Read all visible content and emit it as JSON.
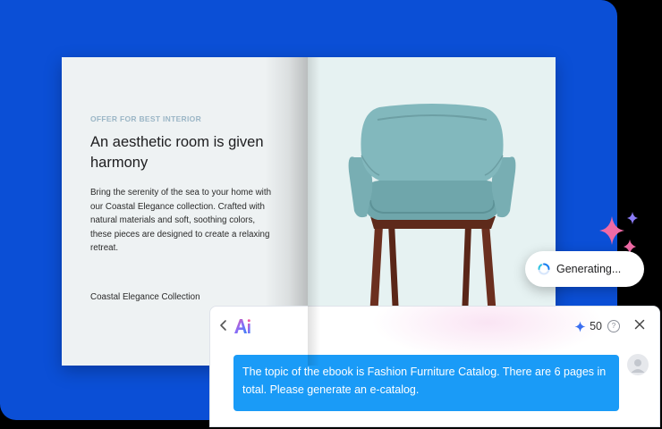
{
  "book": {
    "kicker": "OFFER FOR BEST INTERIOR",
    "headline": "An aesthetic room is given harmony",
    "body": "Bring the serenity of the sea to your home with our Coastal Elegance collection. Crafted with natural materials and soft, soothing colors, these pieces are designed to create a relaxing retreat.",
    "collection": "Coastal Elegance Collection",
    "image_icon": "armchair-image"
  },
  "status": {
    "generating_label": "Generating...",
    "icon": "loading-spinner-icon"
  },
  "chat": {
    "back_icon": "chevron-left-icon",
    "logo_text": "Ai",
    "credits": "50",
    "credit_icon": "sparkle-icon",
    "help_symbol": "?",
    "close_icon": "close-icon",
    "message": "The topic of the ebook is Fashion Furniture Catalog. There are 6 pages in total. Please generate an e-catalog.",
    "avatar_icon": "user-avatar-icon"
  },
  "colors": {
    "background_panel": "#0b4fd6",
    "message_bubble": "#1a9bf7",
    "chair_fabric": "#7fb3b8",
    "chair_legs": "#6b2f1f",
    "sparkle_pink": "#f06aa5",
    "sparkle_purple": "#8b7cf6"
  }
}
